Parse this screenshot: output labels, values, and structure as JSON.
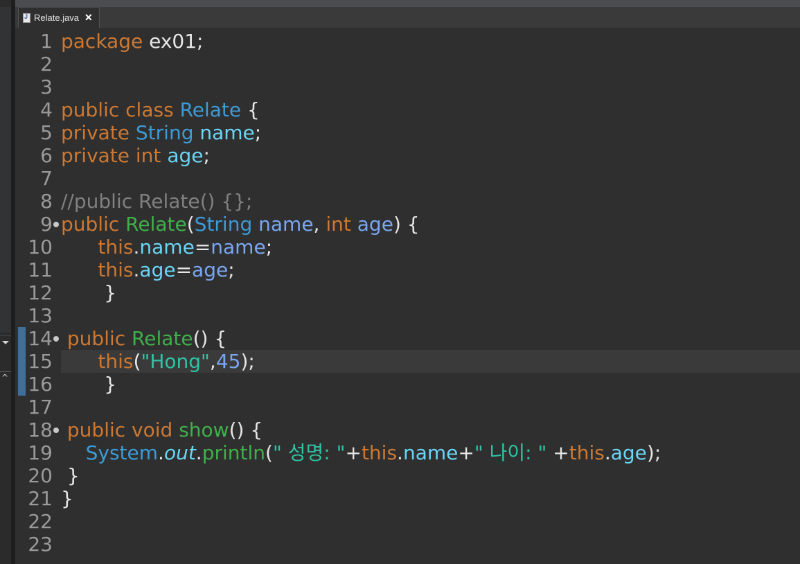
{
  "tab": {
    "filename": "Relate.java"
  },
  "lines": [
    [
      {
        "t": "package",
        "c": "kw"
      },
      {
        "t": " ex01;",
        "c": "plain"
      }
    ],
    [],
    [],
    [
      {
        "t": "public class ",
        "c": "kw"
      },
      {
        "t": "Relate",
        "c": "type"
      },
      {
        "t": " {",
        "c": "plain"
      }
    ],
    [
      {
        "t": "private ",
        "c": "kw"
      },
      {
        "t": "String ",
        "c": "type"
      },
      {
        "t": "name",
        "c": "field"
      },
      {
        "t": ";",
        "c": "plain"
      }
    ],
    [
      {
        "t": "private int ",
        "c": "kw"
      },
      {
        "t": "age",
        "c": "field"
      },
      {
        "t": ";",
        "c": "plain"
      }
    ],
    [],
    [
      {
        "t": "//public Relate() {};",
        "c": "cm"
      }
    ],
    [
      {
        "t": "public ",
        "c": "kw"
      },
      {
        "t": "Relate",
        "c": "method"
      },
      {
        "t": "(",
        "c": "plain"
      },
      {
        "t": "String ",
        "c": "type"
      },
      {
        "t": "name",
        "c": "param"
      },
      {
        "t": ", ",
        "c": "plain"
      },
      {
        "t": "int ",
        "c": "kw"
      },
      {
        "t": "age",
        "c": "param"
      },
      {
        "t": ") {",
        "c": "plain"
      }
    ],
    [
      {
        "t": "      ",
        "c": "plain"
      },
      {
        "t": "this",
        "c": "kw"
      },
      {
        "t": ".",
        "c": "plain"
      },
      {
        "t": "name",
        "c": "field"
      },
      {
        "t": "=",
        "c": "plain"
      },
      {
        "t": "name",
        "c": "param"
      },
      {
        "t": ";",
        "c": "plain"
      }
    ],
    [
      {
        "t": "      ",
        "c": "plain"
      },
      {
        "t": "this",
        "c": "kw"
      },
      {
        "t": ".",
        "c": "plain"
      },
      {
        "t": "age",
        "c": "field"
      },
      {
        "t": "=",
        "c": "plain"
      },
      {
        "t": "age",
        "c": "param"
      },
      {
        "t": ";",
        "c": "plain"
      }
    ],
    [
      {
        "t": "       }",
        "c": "plain"
      }
    ],
    [],
    [
      {
        "t": " public ",
        "c": "kw"
      },
      {
        "t": "Relate",
        "c": "method"
      },
      {
        "t": "() {",
        "c": "plain"
      }
    ],
    [
      {
        "t": "      ",
        "c": "plain"
      },
      {
        "t": "this",
        "c": "kw"
      },
      {
        "t": "(",
        "c": "plain"
      },
      {
        "t": "\"Hong\"",
        "c": "str"
      },
      {
        "t": ",",
        "c": "plain"
      },
      {
        "t": "45",
        "c": "num"
      },
      {
        "t": ");",
        "c": "plain"
      }
    ],
    [
      {
        "t": "       }",
        "c": "plain"
      }
    ],
    [],
    [
      {
        "t": " public void ",
        "c": "kw"
      },
      {
        "t": "show",
        "c": "method"
      },
      {
        "t": "() {",
        "c": "plain"
      }
    ],
    [
      {
        "t": "    ",
        "c": "plain"
      },
      {
        "t": "System",
        "c": "type"
      },
      {
        "t": ".",
        "c": "plain"
      },
      {
        "t": "out",
        "c": "field italic"
      },
      {
        "t": ".",
        "c": "plain"
      },
      {
        "t": "println",
        "c": "method"
      },
      {
        "t": "(",
        "c": "plain"
      },
      {
        "t": "\" 성명: \"",
        "c": "str"
      },
      {
        "t": "+",
        "c": "plain"
      },
      {
        "t": "this",
        "c": "kw"
      },
      {
        "t": ".",
        "c": "plain"
      },
      {
        "t": "name",
        "c": "field"
      },
      {
        "t": "+",
        "c": "plain"
      },
      {
        "t": "\" 나이: \"",
        "c": "str"
      },
      {
        "t": " +",
        "c": "plain"
      },
      {
        "t": "this",
        "c": "kw"
      },
      {
        "t": ".",
        "c": "plain"
      },
      {
        "t": "age",
        "c": "field"
      },
      {
        "t": ");",
        "c": "plain"
      }
    ],
    [
      {
        "t": " }",
        "c": "plain"
      }
    ],
    [
      {
        "t": "}",
        "c": "plain"
      }
    ],
    [],
    []
  ],
  "line_numbers": [
    "1",
    "2",
    "3",
    "4",
    "5",
    "6",
    "7",
    "8",
    "9",
    "10",
    "11",
    "12",
    "13",
    "14",
    "15",
    "16",
    "17",
    "18",
    "19",
    "20",
    "21",
    "22",
    "23"
  ],
  "fold_lines": [
    9,
    14,
    18
  ],
  "current_line": 15,
  "changed_lines": [
    14,
    15,
    16
  ],
  "colors": {
    "keyword": "#cc7832",
    "type": "#3d9bd6",
    "field": "#6ad5f5",
    "method": "#3fb04a",
    "string": "#2ec4a4",
    "comment": "#808080"
  }
}
